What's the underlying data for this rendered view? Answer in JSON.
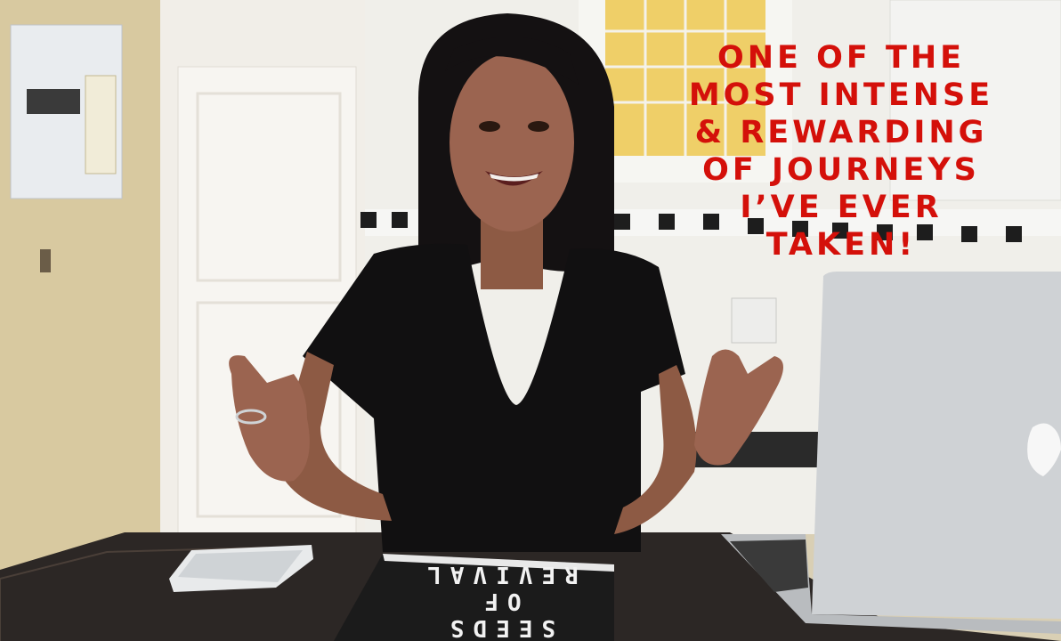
{
  "caption": {
    "lines": [
      "ONE OF THE",
      "MOST INTENSE",
      "& REWARDING",
      "OF JOURNEYS",
      "I’VE EVER",
      "TAKEN!"
    ],
    "color": "#d4100a"
  },
  "book": {
    "title_lines": [
      "SEEDS",
      "OF",
      "REVIVAL"
    ]
  }
}
